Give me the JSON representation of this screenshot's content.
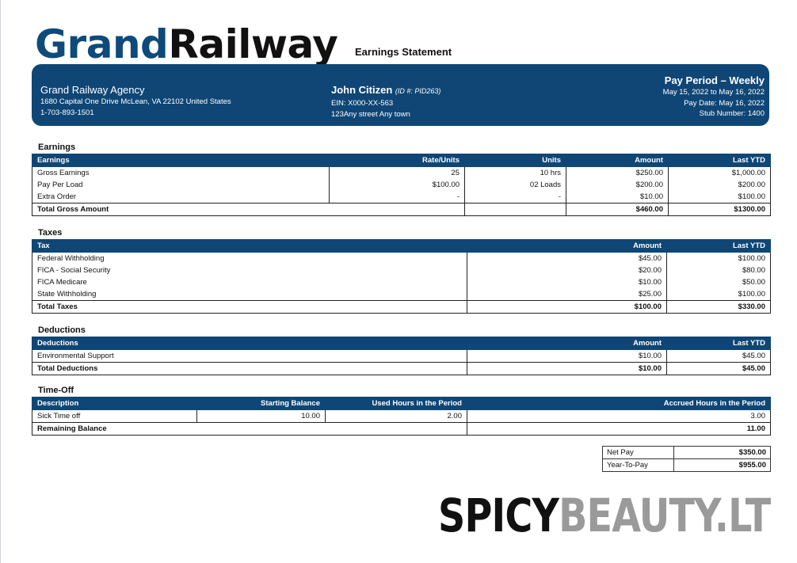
{
  "brand": {
    "part1": "Grand",
    "part2": "Railway"
  },
  "document_title": "Earnings Statement",
  "company": {
    "name": "Grand Railway Agency",
    "address": "1680 Capital One Drive McLean, VA 22102 United States",
    "phone": "1-703-893-1501"
  },
  "employee": {
    "name": "John Citizen",
    "id_text": "(ID #:  PID263)",
    "ein": "EIN: X000-XX-563",
    "address": "123Any street Any town"
  },
  "pay_period": {
    "title": "Pay Period – Weekly",
    "range": "May 15, 2022 to May 16, 2022",
    "pay_date": "Pay Date: May 16, 2022",
    "stub": "Stub Number: 1400"
  },
  "earnings": {
    "section_title": "Earnings",
    "headers": [
      "Earnings",
      "Rate/Units",
      "Units",
      "Amount",
      "Last YTD"
    ],
    "rows": [
      [
        "Gross Earnings",
        "25",
        "10 hrs",
        "$250.00",
        "$1,000.00"
      ],
      [
        "Pay Per Load",
        "$100.00",
        "02 Loads",
        "$200.00",
        "$200.00"
      ],
      [
        "Extra Order",
        "-",
        "-",
        "$10.00",
        "$100.00"
      ]
    ],
    "total": {
      "label": "Total Gross Amount",
      "amount": "$460.00",
      "ytd": "$1300.00"
    }
  },
  "taxes": {
    "section_title": "Taxes",
    "headers": [
      "Tax",
      "Amount",
      "Last YTD"
    ],
    "rows": [
      [
        "Federal Withholding",
        "$45.00",
        "$100.00"
      ],
      [
        "FICA - Social Security",
        "$20.00",
        "$80.00"
      ],
      [
        "FICA Medicare",
        "$10.00",
        "$50.00"
      ],
      [
        "State Withholding",
        "$25.00",
        "$100.00"
      ]
    ],
    "total": {
      "label": "Total Taxes",
      "amount": "$100.00",
      "ytd": "$330.00"
    }
  },
  "deductions": {
    "section_title": "Deductions",
    "headers": [
      "Deductions",
      "Amount",
      "Last YTD"
    ],
    "rows": [
      [
        "Environmental Support",
        "$10.00",
        "$45.00"
      ]
    ],
    "total": {
      "label": "Total Deductions",
      "amount": "$10.00",
      "ytd": "$45.00"
    }
  },
  "timeoff": {
    "section_title": "Time-Off",
    "headers": [
      "Description",
      "Starting Balance",
      "Used Hours in the Period",
      "Accrued Hours in the Period"
    ],
    "rows": [
      [
        "Sick Time off",
        "10.00",
        "2.00",
        "3.00"
      ]
    ],
    "total": {
      "label": "Remaining Balance",
      "value": "11.00"
    }
  },
  "summary": {
    "net_pay_label": "Net Pay",
    "net_pay_value": "$350.00",
    "ytp_label": "Year-To-Pay",
    "ytp_value": "$955.00"
  },
  "watermark": {
    "part1": "SPICY",
    "part2": "BEAUTY.LT"
  }
}
